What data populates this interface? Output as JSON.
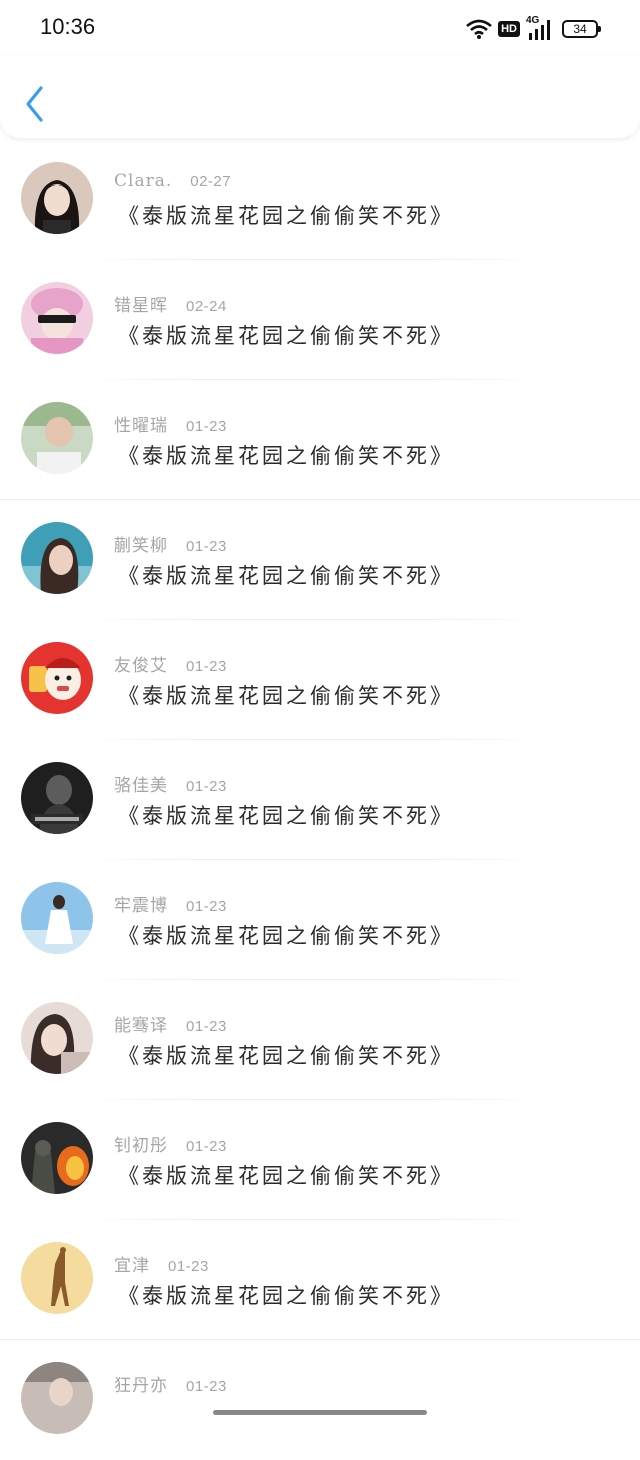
{
  "status_bar": {
    "time": "10:36",
    "hd_label": "HD",
    "network_label": "4G",
    "battery_level": "34"
  },
  "nav": {
    "back_icon": "chevron-left-icon",
    "accent_color": "#3a9bf0"
  },
  "comments": [
    {
      "name": "Clara.",
      "date": "02-27",
      "text": "《泰版流星花园之偷偷笑不死》",
      "avatar": "girl-portrait"
    },
    {
      "name": "错星晖",
      "date": "02-24",
      "text": "《泰版流星花园之偷偷笑不死》",
      "avatar": "pink-sunglasses"
    },
    {
      "name": "性曜瑞",
      "date": "01-23",
      "text": "《泰版流星花园之偷偷笑不死》",
      "avatar": "outdoor-portrait"
    },
    {
      "name": "蒯笑柳",
      "date": "01-23",
      "text": "《泰版流星花园之偷偷笑不死》",
      "avatar": "sea-portrait"
    },
    {
      "name": "友俊艾",
      "date": "01-23",
      "text": "《泰版流星花园之偷偷笑不死》",
      "avatar": "red-envelope-cartoon"
    },
    {
      "name": "骆佳美",
      "date": "01-23",
      "text": "《泰版流星花园之偷偷笑不死》",
      "avatar": "dark-photo"
    },
    {
      "name": "牢震博",
      "date": "01-23",
      "text": "《泰版流星花园之偷偷笑不死》",
      "avatar": "sky-figure"
    },
    {
      "name": "能骞译",
      "date": "01-23",
      "text": "《泰版流星花园之偷偷笑不死》",
      "avatar": "soft-portrait"
    },
    {
      "name": "钊初彤",
      "date": "01-23",
      "text": "《泰版流星花园之偷偷笑不死》",
      "avatar": "fire-soldier"
    },
    {
      "name": "宜津",
      "date": "01-23",
      "text": "《泰版流星花园之偷偷笑不死》",
      "avatar": "giraffe"
    },
    {
      "name": "狂丹亦",
      "date": "01-23",
      "text": "",
      "avatar": "partial-photo"
    }
  ]
}
